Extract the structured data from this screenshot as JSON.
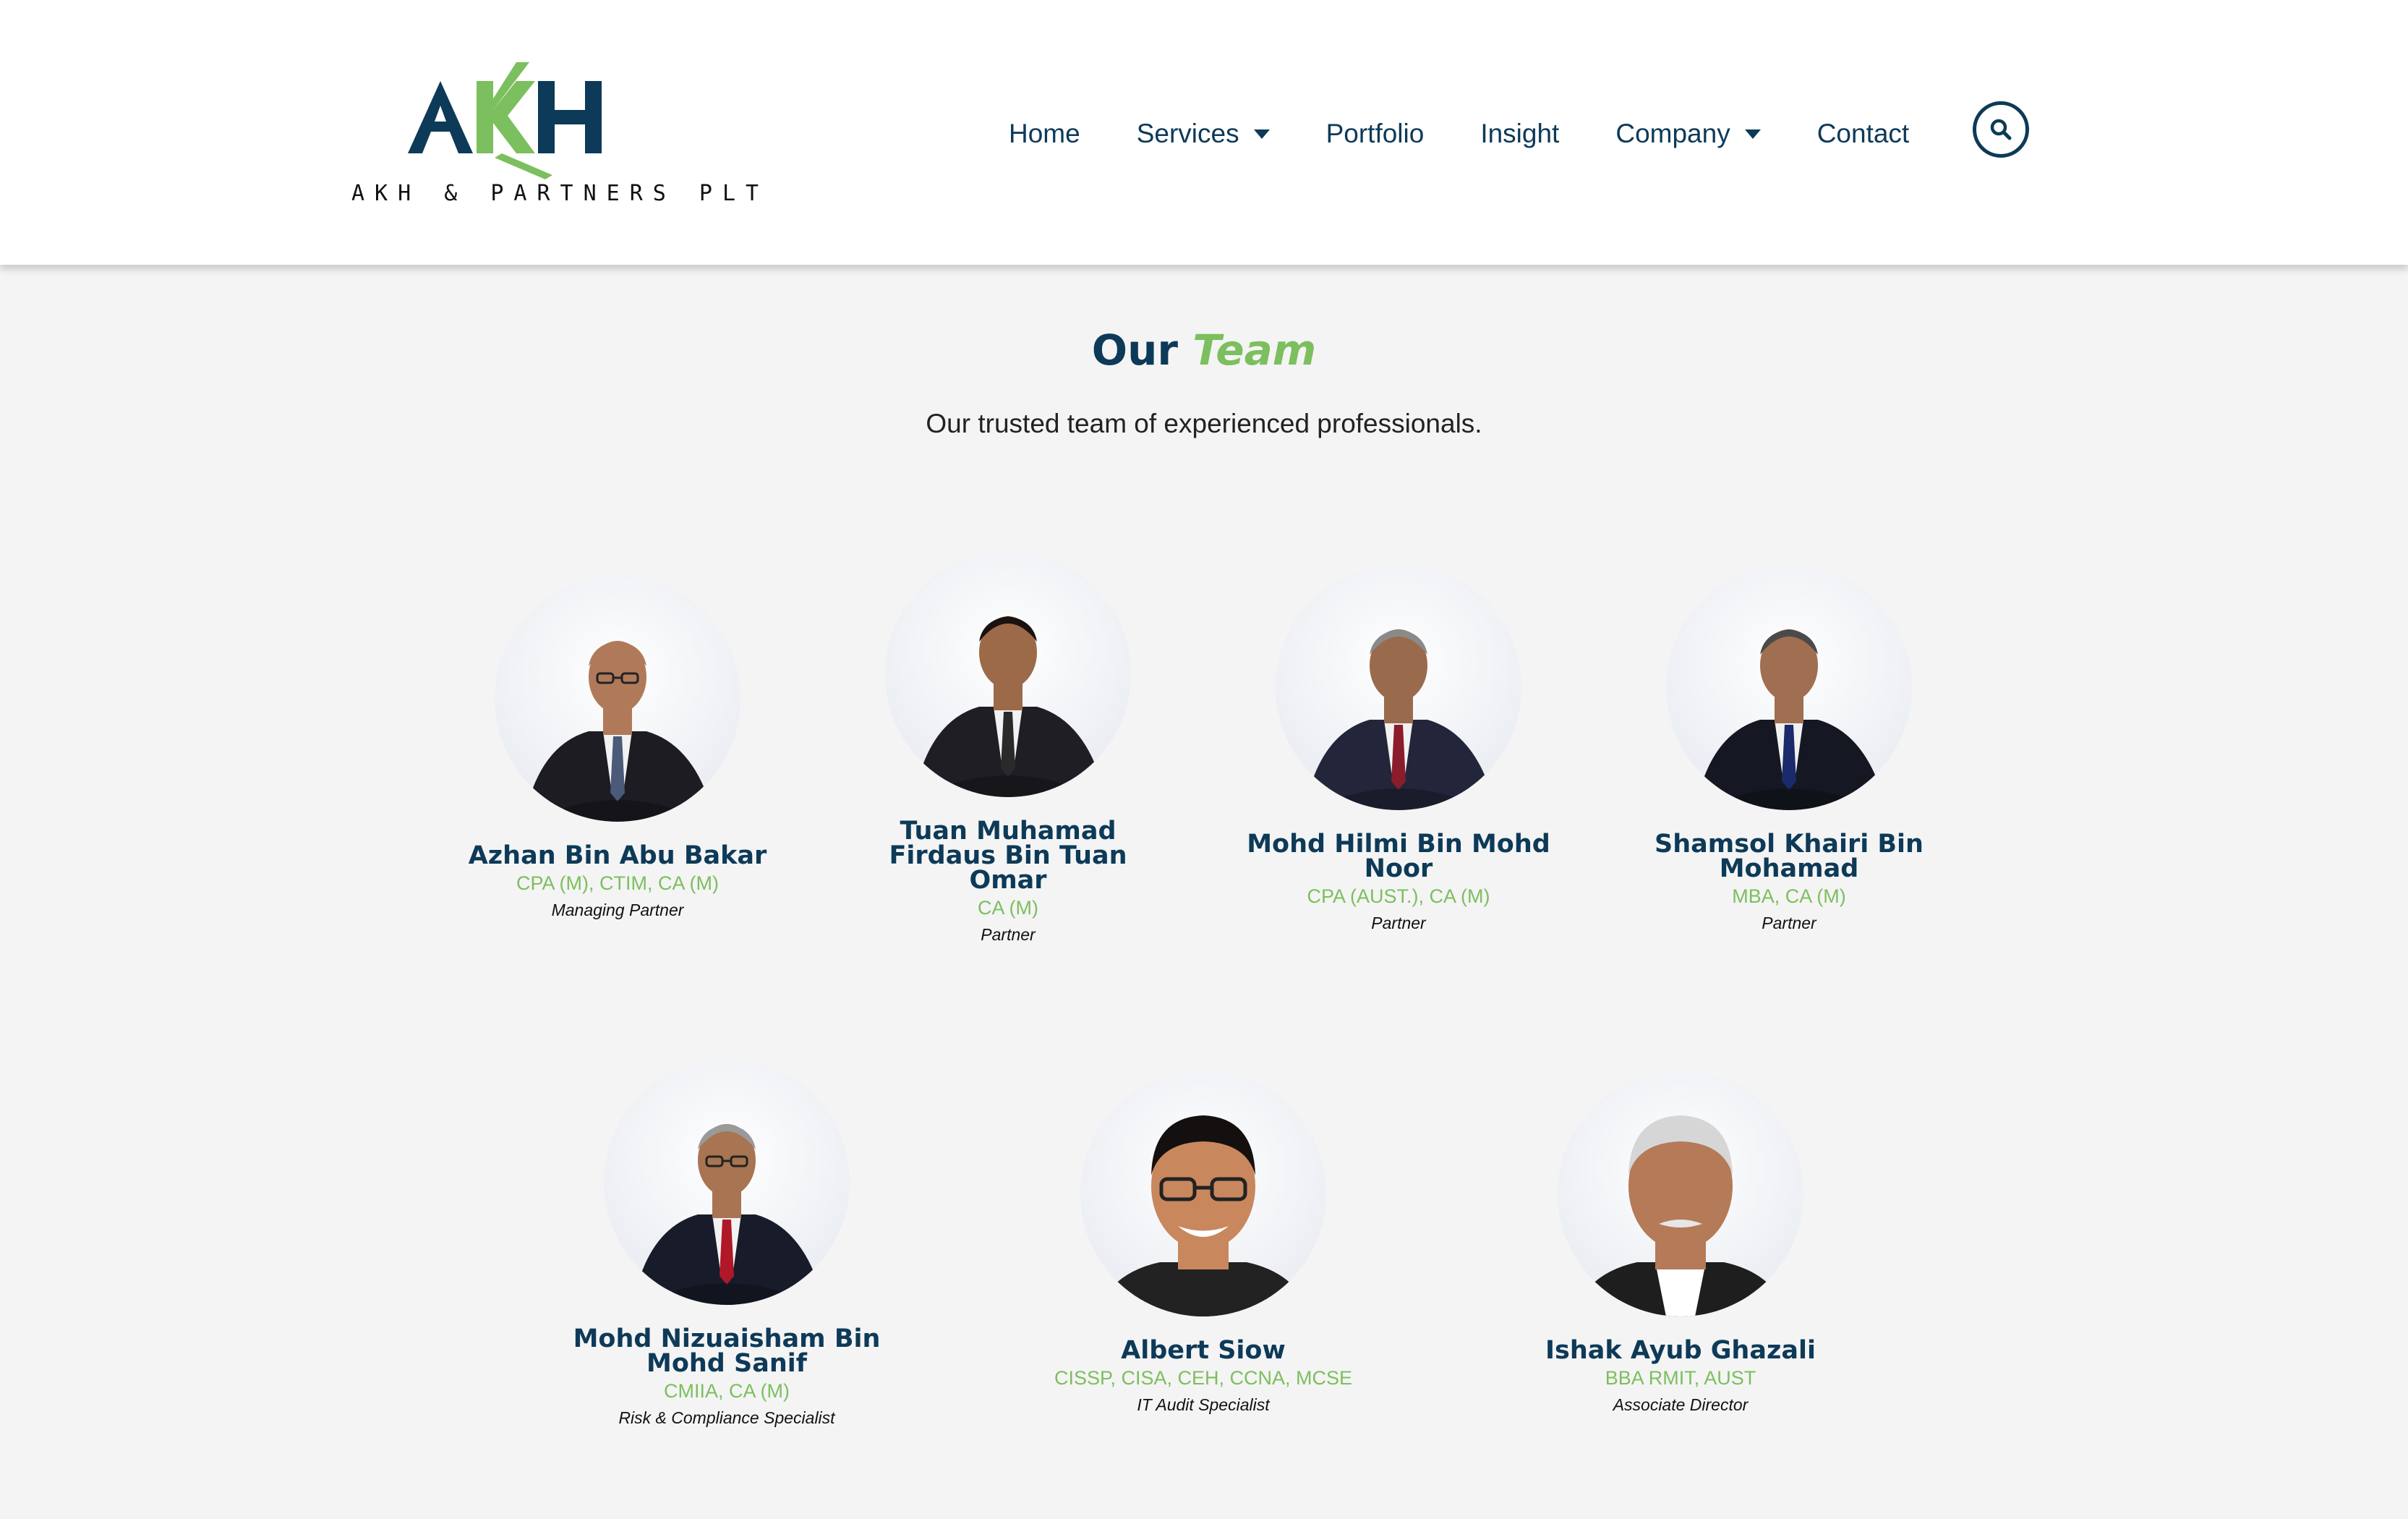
{
  "brand": {
    "logo_letters": "AKH",
    "logo_tagline": "AKH & PARTNERS PLT"
  },
  "nav": {
    "items": [
      {
        "label": "Home",
        "dropdown": false
      },
      {
        "label": "Services",
        "dropdown": true
      },
      {
        "label": "Portfolio",
        "dropdown": false
      },
      {
        "label": "Insight",
        "dropdown": false
      },
      {
        "label": "Company",
        "dropdown": true
      },
      {
        "label": "Contact",
        "dropdown": false
      }
    ],
    "search_icon": "search-icon"
  },
  "section": {
    "title_part1": "Our",
    "title_part2": "Team",
    "subtitle": "Our trusted team of experienced professionals."
  },
  "team": [
    {
      "name": "Azhan Bin Abu Bakar",
      "credentials": "CPA (M), CTIM, CA (M)",
      "role": "Managing Partner"
    },
    {
      "name": "Tuan Muhamad Firdaus Bin Tuan Omar",
      "credentials": "CA (M)",
      "role": "Partner"
    },
    {
      "name": "Mohd Hilmi Bin Mohd Noor",
      "credentials": "CPA (AUST.), CA (M)",
      "role": "Partner"
    },
    {
      "name": "Shamsol Khairi Bin Mohamad",
      "credentials": "MBA, CA (M)",
      "role": "Partner"
    },
    {
      "name": "Mohd Nizuaisham Bin Mohd Sanif",
      "credentials": "CMIIA, CA (M)",
      "role": "Risk & Compliance Specialist"
    },
    {
      "name": "Albert Siow",
      "credentials": "CISSP, CISA, CEH, CCNA, MCSE",
      "role": "IT Audit Specialist"
    },
    {
      "name": "Ishak Ayub Ghazali",
      "credentials": "BBA RMIT, AUST",
      "role": "Associate Director"
    }
  ],
  "colors": {
    "navy": "#0d3a58",
    "green": "#7cbf5e",
    "background": "#f4f4f4"
  }
}
